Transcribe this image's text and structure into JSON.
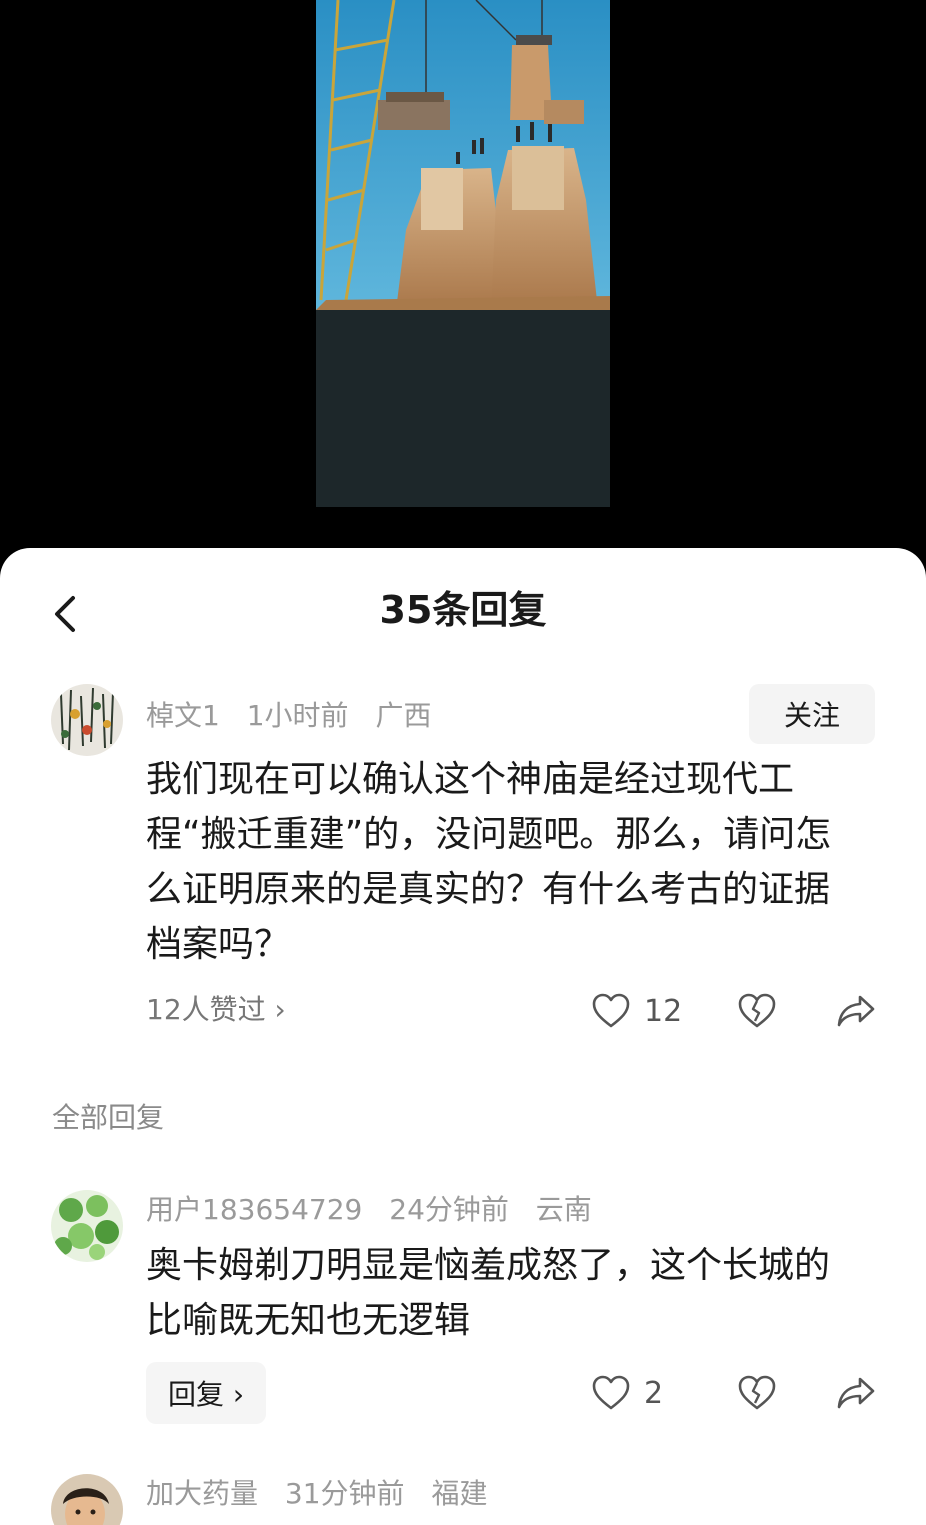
{
  "header": {
    "title": "35条回复",
    "back_icon": "chevron-left-icon"
  },
  "main_comment": {
    "username": "棹文1",
    "time": "1小时前",
    "location": "广西",
    "follow_label": "关注",
    "text": "我们现在可以确认这个神庙是经过现代工程“搬迁重建”的，没问题吧。那么，请问怎么证明原来的是真实的？有什么考古的证据档案吗？",
    "liked_by": "12人赞过 ›",
    "like_count": "12"
  },
  "section_label": "全部回复",
  "replies": [
    {
      "username": "用户183654729",
      "time": "24分钟前",
      "location": "云南",
      "text": "奥卡姆剃刀明显是恼羞成怒了，这个长城的比喻既无知也无逻辑",
      "reply_label": "回复 ›",
      "like_count": "2"
    },
    {
      "username": "加大药量",
      "time": "31分钟前",
      "location": "福建"
    }
  ],
  "colors": {
    "sheet_bg": "#ffffff",
    "meta_text": "#9a9a9a",
    "body_text": "#1a1a1a",
    "icon_stroke": "#555555"
  }
}
